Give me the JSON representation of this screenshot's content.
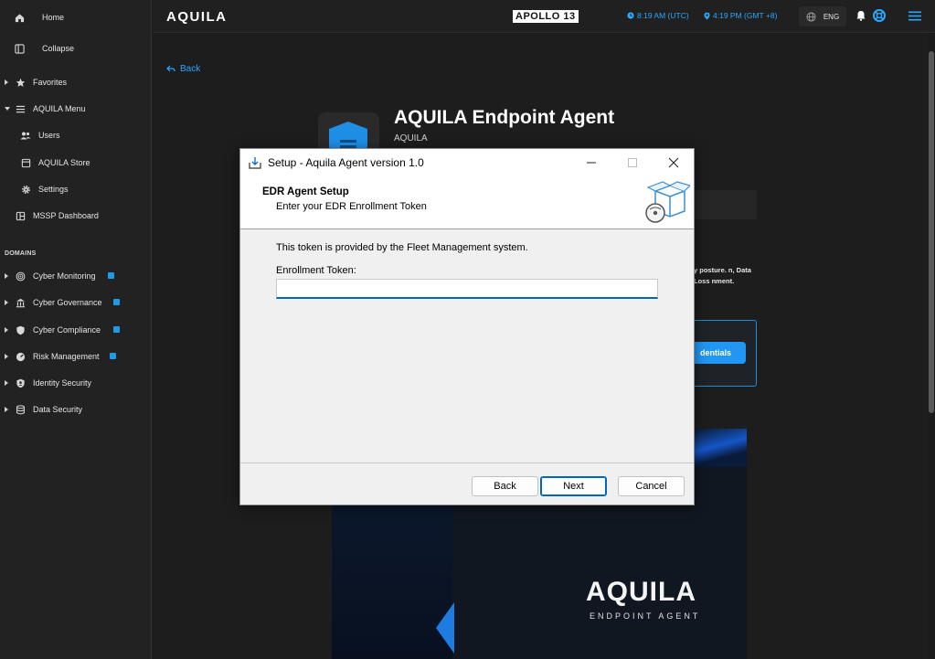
{
  "sidebar": {
    "home": "Home",
    "collapse": "Collapse",
    "favorites": "Favorites",
    "aquila_menu": "AQUILA Menu",
    "users": "Users",
    "aquila_store": "AQUILA Store",
    "settings": "Settings",
    "mssp_dashboard": "MSSP Dashboard",
    "domains_title": "DOMAINS",
    "domains": [
      {
        "label": "Cyber Monitoring"
      },
      {
        "label": "Cyber Governance"
      },
      {
        "label": "Cyber Compliance"
      },
      {
        "label": "Risk Management"
      },
      {
        "label": "Identity Security"
      },
      {
        "label": "Data Security"
      }
    ]
  },
  "topbar": {
    "logo": "AQUILA",
    "apollo": "APOLLO 13",
    "utc_time": "8:19 AM (UTC)",
    "local_time": "4:19 PM (GMT +8)",
    "language": "ENG",
    "accent": "#2aa8ff"
  },
  "main": {
    "back_label": "Back",
    "app_title": "AQUILA Endpoint Agent",
    "app_vendor": "AQUILA",
    "desc_partial": "y posture. n, Data Loss nment.",
    "cred_button": "dentials",
    "promo_logo": "AQUILA",
    "promo_tagline": "ENDPOINT AGENT"
  },
  "dialog": {
    "title": "Setup - Aquila Agent version 1.0",
    "header_title": "EDR Agent Setup",
    "header_subtitle": "Enter your EDR Enrollment Token",
    "body_text": "This token is provided by the Fleet Management system.",
    "field_label": "Enrollment Token:",
    "field_value": "",
    "back_button": "Back",
    "next_button": "Next",
    "cancel_button": "Cancel"
  }
}
